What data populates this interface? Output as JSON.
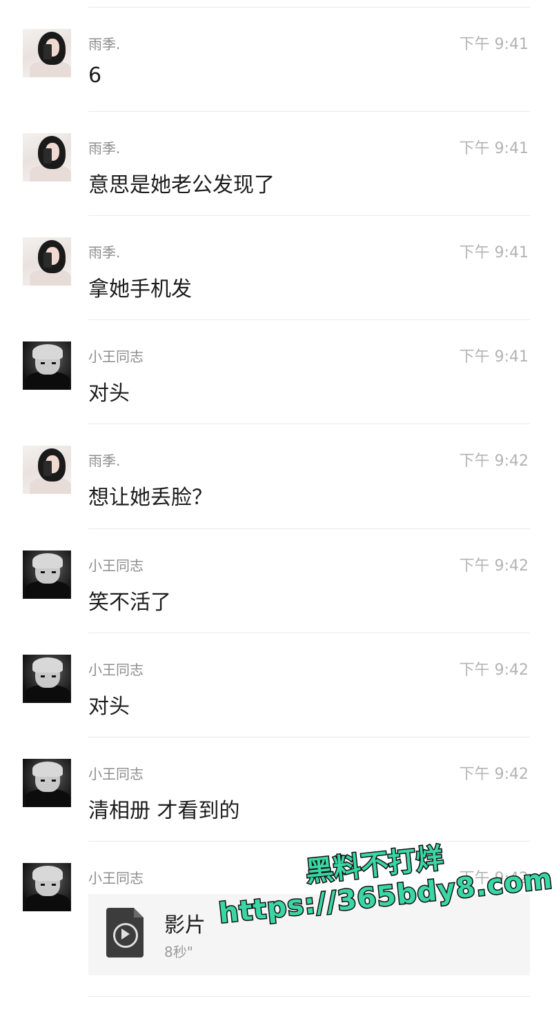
{
  "messages": [
    {
      "sender": "雨季.",
      "time": "下午 9:41",
      "text": "6",
      "avatar": "girl"
    },
    {
      "sender": "雨季.",
      "time": "下午 9:41",
      "text": "意思是她老公发现了",
      "avatar": "girl"
    },
    {
      "sender": "雨季.",
      "time": "下午 9:41",
      "text": "拿她手机发",
      "avatar": "girl"
    },
    {
      "sender": "小王同志",
      "time": "下午 9:41",
      "text": "对头",
      "avatar": "boy"
    },
    {
      "sender": "雨季.",
      "time": "下午 9:42",
      "text": "想让她丢脸？",
      "avatar": "girl"
    },
    {
      "sender": "小王同志",
      "time": "下午 9:42",
      "text": "笑不活了",
      "avatar": "boy"
    },
    {
      "sender": "小王同志",
      "time": "下午 9:42",
      "text": "对头",
      "avatar": "boy"
    },
    {
      "sender": "小王同志",
      "time": "下午 9:42",
      "text": "清相册 才看到的",
      "avatar": "boy"
    },
    {
      "sender": "小王同志",
      "time": "下午 9:42",
      "text": "",
      "avatar": "boy"
    }
  ],
  "file": {
    "name": "影片",
    "duration": "8秒\"",
    "icon": "video-file-icon"
  },
  "watermark": {
    "line1": "黑料不打烊",
    "line2": "https://365bdy8.com"
  },
  "colors": {
    "watermark_fill": "#3ad6a4",
    "divider": "#e9e9e9",
    "time": "#b3b3b3"
  }
}
